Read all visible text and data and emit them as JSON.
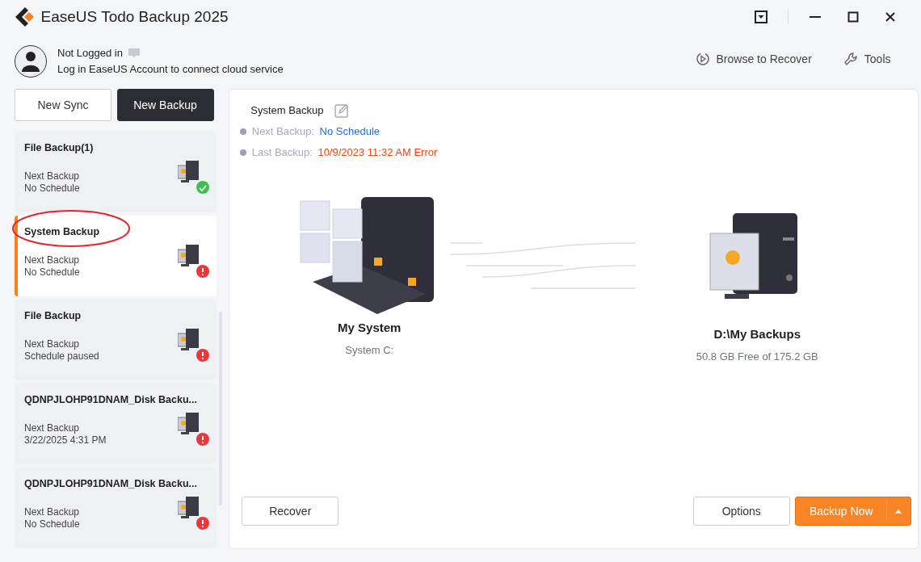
{
  "window": {
    "title": "EaseUS Todo Backup 2025"
  },
  "account": {
    "name": "Not Logged in",
    "hint": "Log in EaseUS Account to connect cloud service"
  },
  "toolbar": [
    {
      "label": "Browse to Recover",
      "kind": "browse"
    },
    {
      "label": "Tools",
      "kind": "tools"
    }
  ],
  "actions": [
    {
      "label": "New Sync",
      "kind": "plain"
    },
    {
      "label": "New Backup",
      "kind": "dark"
    }
  ],
  "tasks": [
    {
      "title": "File Backup(1)",
      "next_label": "Next Backup",
      "next_value": "No Schedule",
      "error": false,
      "selected": false,
      "circled": false
    },
    {
      "title": "System Backup",
      "next_label": "Next Backup",
      "next_value": "No Schedule",
      "error": true,
      "selected": true,
      "circled": true
    },
    {
      "title": "File Backup",
      "next_label": "Next Backup",
      "next_value": "Schedule paused",
      "error": true,
      "selected": false,
      "circled": false
    },
    {
      "title": "QDNPJLOHP91DNAM_Disk Backu...",
      "next_label": "Next Backup",
      "next_value": "3/22/2025 4:31 PM",
      "error": true,
      "selected": false,
      "circled": false
    },
    {
      "title": "QDNPJLOHP91DNAM_Disk Backu...",
      "next_label": "Next Backup",
      "next_value": "No Schedule",
      "error": true,
      "selected": false,
      "circled": false
    }
  ],
  "detail": {
    "title": "System Backup",
    "info": [
      {
        "label": "Next Backup:",
        "value": "No Schedule",
        "kind": "info"
      },
      {
        "label": "Last Backup:",
        "value": "10/9/2023 11:32 AM Error",
        "kind": "error"
      }
    ],
    "source": {
      "name": "My System",
      "sub": "System C:"
    },
    "target": {
      "name": "D:\\My Backups",
      "sub": "50.8 GB Free of 175.2 GB"
    },
    "buttons": [
      {
        "label": "Recover",
        "kind": "plain"
      },
      {
        "label": "Options",
        "kind": "plain"
      },
      {
        "label": "Backup Now",
        "kind": "primary"
      }
    ]
  }
}
